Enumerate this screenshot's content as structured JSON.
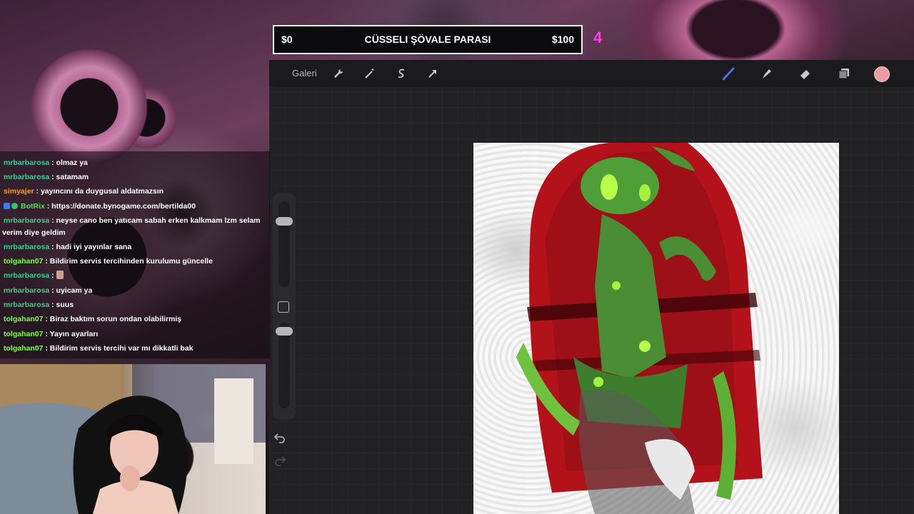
{
  "goal": {
    "min": "$0",
    "title": "CÜSSELI ŞÖVALE PARASI",
    "max": "$100",
    "count": "4"
  },
  "procreate": {
    "gallery_label": "Galeri",
    "tools": [
      "wrench-icon",
      "magic-wand-icon",
      "selection-icon",
      "transform-arrow-icon",
      "brush-icon",
      "smudge-icon",
      "eraser-icon",
      "layers-icon"
    ],
    "current_color": "#ee9aa2"
  },
  "chat": {
    "messages": [
      {
        "user": "mrbarbarosa",
        "text": ": olmaz ya",
        "color": "#3ccf8f"
      },
      {
        "user": "mrbarbarosa",
        "text": ": satamam",
        "color": "#3ccf8f"
      },
      {
        "user": "simyajer",
        "text": ": yayıncını da duygusal aldatmazsın",
        "color": "#f0a030"
      },
      {
        "user": "BotRix",
        "text": ": https://donate.bynogame.com/bertilda00",
        "color": "#56d957"
      },
      {
        "user": "mrbarbarosa",
        "text": ": neyse cano ben yatıcam sabah erken kalkmam lzm selam verim diye geldim",
        "color": "#3ccf8f"
      },
      {
        "user": "mrbarbarosa",
        "text": ": hadi iyi yayınlar sana",
        "color": "#3ccf8f"
      },
      {
        "user": "tolgahan07",
        "text": ": Bildirim servis tercihinden kurulumu güncelle",
        "color": "#7dff4a"
      },
      {
        "user": "mrbarbarosa",
        "text": ":",
        "color": "#3ccf8f"
      },
      {
        "user": "mrbarbarosa",
        "text": ": uyicam ya",
        "color": "#3ccf8f"
      },
      {
        "user": "mrbarbarosa",
        "text": ": suus",
        "color": "#3ccf8f"
      },
      {
        "user": "tolgahan07",
        "text": ": Biraz baktım sorun ondan olabilirmiş",
        "color": "#7dff4a"
      },
      {
        "user": "tolgahan07",
        "text": ": Yayın ayarları",
        "color": "#7dff4a"
      },
      {
        "user": "tolgahan07",
        "text": ": Bildirim servis tercihi var mı dikkatli bak",
        "color": "#7dff4a"
      }
    ]
  }
}
